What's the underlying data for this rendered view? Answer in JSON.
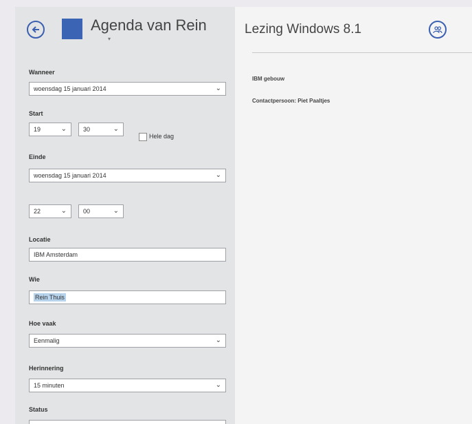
{
  "colors": {
    "accent": "#3a5fb0",
    "calendar_color": "#3c64b4",
    "selection": "#b7d3ec"
  },
  "calendar": {
    "name": "Agenda van Rein"
  },
  "form": {
    "when": {
      "label": "Wanneer",
      "value": "woensdag 15 januari 2014"
    },
    "start": {
      "label": "Start",
      "hour": "19",
      "minute": "30",
      "all_day_label": "Hele dag",
      "all_day": false
    },
    "end": {
      "label": "Einde",
      "date": "woensdag 15 januari 2014",
      "hour": "22",
      "minute": "00"
    },
    "location": {
      "label": "Locatie",
      "value": "IBM Amsterdam"
    },
    "who": {
      "label": "Wie",
      "value": "Rein Thuis"
    },
    "frequency": {
      "label": "Hoe vaak",
      "value": "Eenmalig"
    },
    "reminder": {
      "label": "Herinnering",
      "value": "15 minuten"
    },
    "status": {
      "label": "Status"
    }
  },
  "event": {
    "title": "Lezing Windows 8.1",
    "details": [
      "IBM gebouw",
      "Contactpersoon: Piet Paaltjes"
    ]
  },
  "icons": {
    "back": "back-arrow-icon",
    "people": "people-icon",
    "dropdown": "chevron-down-icon"
  }
}
